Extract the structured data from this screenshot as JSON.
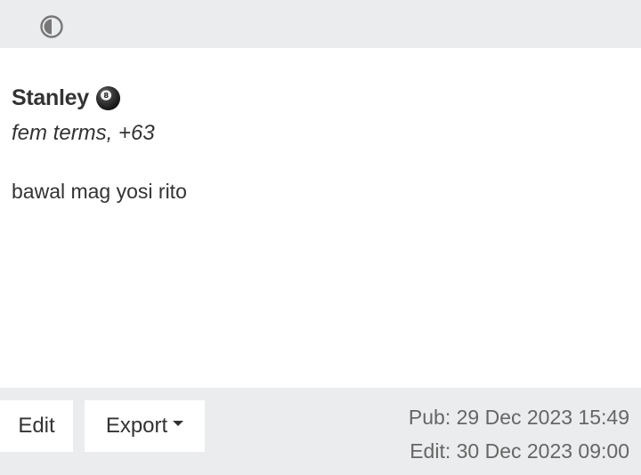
{
  "header": {
    "theme_toggle_icon": "half-circle-contrast-icon"
  },
  "post": {
    "author": "Stanley",
    "author_badge_icon": "eight-ball-icon",
    "subtitle": "fem terms, +63",
    "body": "bawal mag yosi rito"
  },
  "footer": {
    "edit_label": "Edit",
    "export_label": "Export",
    "published": "Pub: 29 Dec 2023 15:49",
    "edited": "Edit: 30 Dec 2023 09:00"
  }
}
